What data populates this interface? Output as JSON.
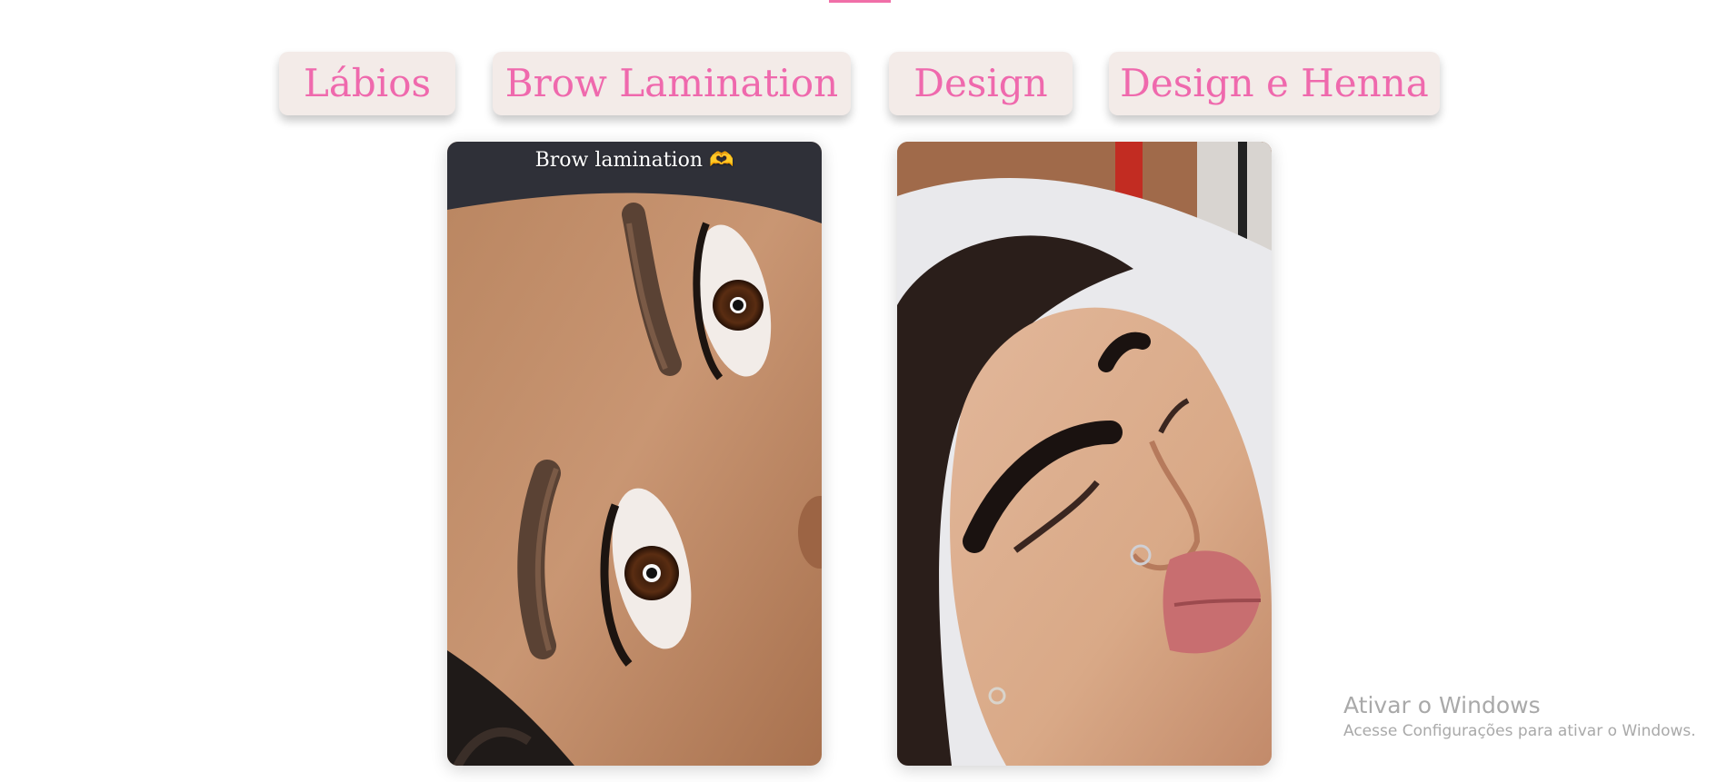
{
  "tabs": [
    {
      "label": "Lábios"
    },
    {
      "label": "Brow Lamination"
    },
    {
      "label": "Design"
    },
    {
      "label": "Design e Henna"
    }
  ],
  "gallery": [
    {
      "caption": "Brow lamination 🫶",
      "subject": "photo of laminated eyebrows, close-up of eyes"
    },
    {
      "caption": "",
      "subject": "photo of eyebrow design on reclining woman"
    }
  ],
  "colors": {
    "accent": "#ef69ad",
    "tab_background": "#f3ebe8",
    "watermark": "#a9a9a9"
  },
  "watermark": {
    "title": "Ativar o Windows",
    "subtitle": "Acesse Configurações para ativar o Windows."
  }
}
